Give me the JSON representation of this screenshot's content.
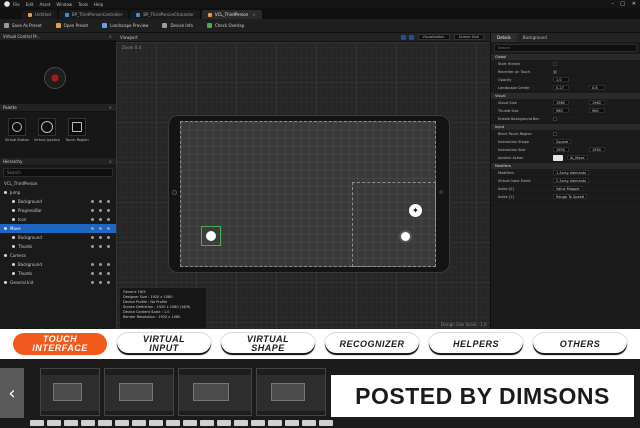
{
  "window": {
    "menu": [
      "File",
      "Edit",
      "Asset",
      "Window",
      "Tools",
      "Help"
    ],
    "controls": [
      "–",
      "□",
      "✕"
    ]
  },
  "tabs": [
    {
      "label": "Untitled",
      "icon": "level-icon",
      "active": false
    },
    {
      "label": "BP_ThirdPersonController",
      "icon": "blueprint-icon",
      "active": false
    },
    {
      "label": "BP_ThirdPersonCharacter",
      "icon": "blueprint-icon",
      "active": false
    },
    {
      "label": "VCL_ThirdPerson",
      "icon": "widget-icon",
      "active": true
    }
  ],
  "toolbar": {
    "save": "Save As Preset",
    "open": "Open Preset",
    "landscape": "Landscape Preview",
    "device": "Device Info",
    "overlap": "Check Overlap"
  },
  "left": {
    "preview_title": "Virtual Control Pr...",
    "palette_title": "Palette",
    "palette_items": [
      {
        "label": "Virtual Button",
        "icon": "button-icon"
      },
      {
        "label": "Virtual Joystick",
        "icon": "joystick-icon"
      },
      {
        "label": "Touch Region",
        "icon": "region-icon"
      }
    ],
    "hierarchy_title": "Hierarchy",
    "search_placeholder": "Search",
    "root": "VCL_ThirdPerson",
    "rows": [
      {
        "label": "Jump",
        "level": 0,
        "selected": false,
        "tools": false
      },
      {
        "label": "Background",
        "level": 1,
        "selected": false,
        "tools": true
      },
      {
        "label": "ProgressBar",
        "level": 1,
        "selected": false,
        "tools": true
      },
      {
        "label": "Icon",
        "level": 1,
        "selected": false,
        "tools": true
      },
      {
        "label": "Move",
        "level": 0,
        "selected": true,
        "tools": true
      },
      {
        "label": "Background",
        "level": 1,
        "selected": false,
        "tools": true
      },
      {
        "label": "Thumb",
        "level": 1,
        "selected": false,
        "tools": true
      },
      {
        "label": "Camera",
        "level": 0,
        "selected": false,
        "tools": false
      },
      {
        "label": "Background",
        "level": 1,
        "selected": false,
        "tools": true
      },
      {
        "label": "Thumb",
        "level": 1,
        "selected": false,
        "tools": true
      },
      {
        "label": "General.Init",
        "level": 0,
        "selected": false,
        "tools": true
      }
    ]
  },
  "viewport": {
    "title": "Viewport",
    "zoom": "Zoom 0.4",
    "dropdown1": "Visualization",
    "dropdown2": "Screen Size",
    "info": [
      "Generic 16/9",
      "Designer Size : 1920 x 1080",
      "Device Profile : No Profile",
      "Screen Definition : 1920 x 1080 (16/9)",
      "Device Content Scale : 1.0",
      "Render Resolution : 1920 x 1080"
    ],
    "scale": "Design Size Scale : 1.0"
  },
  "details": {
    "tabs": [
      "Details",
      "Background"
    ],
    "search_placeholder": "Search",
    "sections": [
      {
        "title": "Global",
        "props": [
          {
            "label": "Start Hidden",
            "type": "check",
            "on": false
          },
          {
            "label": "Recenter on Touch",
            "type": "check",
            "on": true
          },
          {
            "label": "Opacity",
            "type": "value",
            "v1": "1.0"
          },
          {
            "label": "Landscape Center",
            "type": "pair",
            "v1": "0.27",
            "v2": "0.8"
          }
        ]
      },
      {
        "title": "Visual",
        "props": [
          {
            "label": "Visual Size",
            "type": "pair",
            "v1": "1960",
            "v2": "1960"
          },
          {
            "label": "Thumb Size",
            "type": "pair",
            "v1": "960",
            "v2": "960"
          },
          {
            "label": "Enable Background Bar",
            "type": "check",
            "on": false
          }
        ]
      },
      {
        "title": "Input",
        "props": [
          {
            "label": "Block Touch Region",
            "type": "check",
            "on": false
          },
          {
            "label": "Interaction Shape",
            "type": "value",
            "v1": "Square"
          },
          {
            "label": "Interaction Size",
            "type": "pair",
            "v1": "1950",
            "v2": "1950"
          },
          {
            "label": "Joystick Action",
            "type": "thumb",
            "v1": "IA_Move"
          }
        ]
      },
      {
        "title": "Modifiers",
        "props": [
          {
            "label": "Modifiers",
            "type": "value",
            "v1": "1 Array elements"
          },
          {
            "label": "Virtual Input Event",
            "type": "value",
            "v1": "2 Array elements"
          },
          {
            "label": "Index [0]",
            "type": "value",
            "v1": "Value Mapper"
          },
          {
            "label": "Index [1]",
            "type": "value",
            "v1": "Range To Speed"
          }
        ]
      }
    ]
  },
  "banner": {
    "tabs": [
      {
        "label": "TOUCH\nINTERFACE",
        "active": true
      },
      {
        "label": "VIRTUAL\nINPUT",
        "active": false
      },
      {
        "label": "VIRTUAL\nSHAPE",
        "active": false
      },
      {
        "label": "RECOGNIZER",
        "active": false
      },
      {
        "label": "HELPERS",
        "active": false
      },
      {
        "label": "OTHERS",
        "active": false
      }
    ],
    "accent": "#f25a1d"
  },
  "gallery": {
    "prev": "‹"
  },
  "watermark": "POSTED BY DIMSONS"
}
